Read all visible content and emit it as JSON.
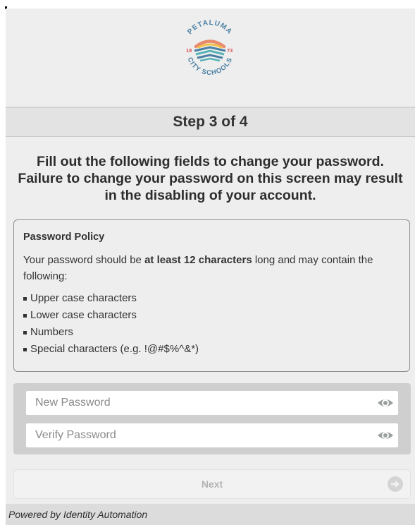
{
  "logo": {
    "top_text": "PETALUMA",
    "year_left": "18",
    "year_right": "73",
    "bottom_text": "CITY SCHOOLS"
  },
  "step": {
    "title": "Step 3 of 4"
  },
  "instructions": "Fill out the following fields to change your password. Failure to change your password on this screen may result in the disabling of your account.",
  "policy": {
    "title": "Password Policy",
    "desc_before": "Your password should be ",
    "desc_bold": "at least 12 characters",
    "desc_after": " long and may contain the following:",
    "items": [
      "Upper case characters",
      "Lower case characters",
      "Numbers",
      "Special characters (e.g. !@#$%^&*)"
    ]
  },
  "form": {
    "new_password_placeholder": "New Password",
    "verify_password_placeholder": "Verify Password",
    "eye_icon": "eye-icon",
    "next_label": "Next",
    "next_icon": "arrow-right-circle-icon"
  },
  "footer": {
    "text": "Powered by Identity Automation"
  },
  "colors": {
    "logo_orange": "#e98a6b",
    "logo_blue": "#4a7fa3",
    "logo_teal": "#56b3b8",
    "logo_yellow": "#f0c24b",
    "logo_red": "#d9534f"
  }
}
